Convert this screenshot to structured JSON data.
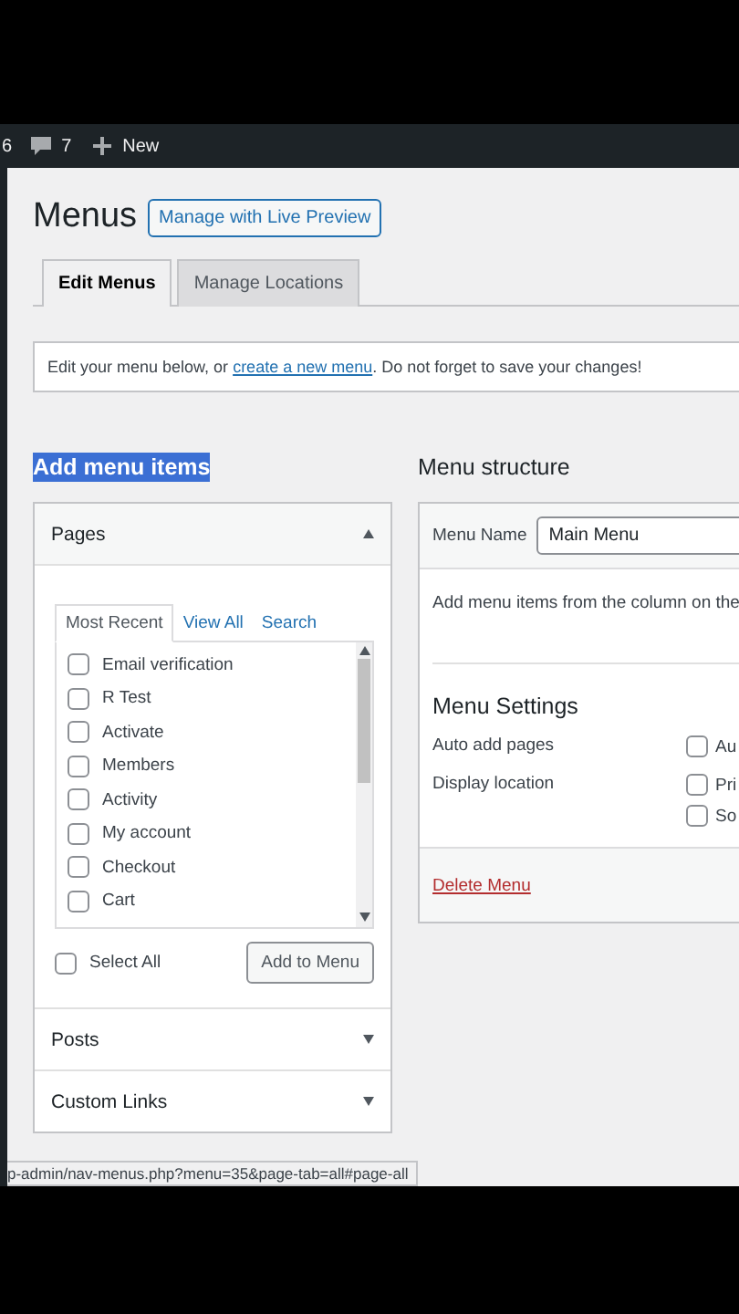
{
  "admin_bar": {
    "updates_count": "6",
    "comments_count": "7",
    "new_label": "New"
  },
  "title": "Menus",
  "preview_button": "Manage with Live Preview",
  "tabs": [
    {
      "label": "Edit Menus",
      "selected": true
    },
    {
      "label": "Manage Locations",
      "selected": false
    }
  ],
  "notice": {
    "before": "Edit your menu below, or ",
    "link": "create a new menu",
    "after": ". Do not forget to save your changes!"
  },
  "add_items": {
    "heading": "Add menu items",
    "highlighted": true,
    "sections": [
      {
        "title": "Pages",
        "expanded": true,
        "tabs": [
          {
            "label": "Most Recent",
            "selected": true
          },
          {
            "label": "View All",
            "selected": false
          },
          {
            "label": "Search",
            "selected": false
          }
        ],
        "items": [
          {
            "label": "Email verification",
            "checked": false
          },
          {
            "label": "R Test",
            "checked": false
          },
          {
            "label": "Activate",
            "checked": false
          },
          {
            "label": "Members",
            "checked": false
          },
          {
            "label": "Activity",
            "checked": false
          },
          {
            "label": "My account",
            "checked": false
          },
          {
            "label": "Checkout",
            "checked": false
          },
          {
            "label": "Cart",
            "checked": false
          }
        ],
        "select_all": {
          "label": "Select All",
          "checked": false
        },
        "button": "Add to Menu"
      },
      {
        "title": "Posts",
        "expanded": false
      },
      {
        "title": "Custom Links",
        "expanded": false
      }
    ]
  },
  "menu_structure": {
    "heading": "Menu structure",
    "name_label": "Menu Name",
    "name_value": "Main Menu",
    "hint": "Add menu items from the column on the",
    "settings_title": "Menu Settings",
    "settings": [
      {
        "label": "Auto add pages",
        "options": [
          {
            "label": "Au",
            "checked": false
          }
        ]
      },
      {
        "label": "Display location",
        "options": [
          {
            "label": "Pri",
            "checked": false
          },
          {
            "label": "So",
            "checked": false
          }
        ]
      }
    ],
    "delete_link": "Delete Menu"
  },
  "status_url": "p-admin/nav-menus.php?menu=35&page-tab=all#page-all"
}
